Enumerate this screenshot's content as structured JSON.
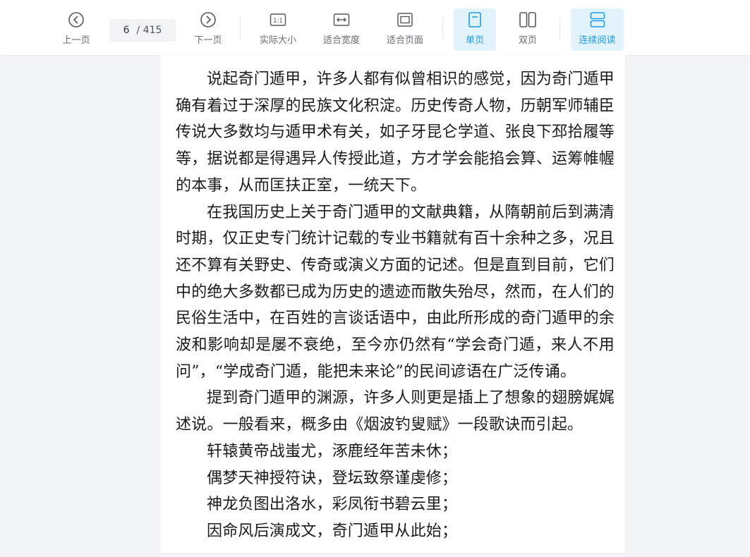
{
  "toolbar": {
    "prev_label": "上一页",
    "current_page": "6",
    "total_pages": "/ 415",
    "next_label": "下一页",
    "actual_size_label": "实际大小",
    "fit_width_label": "适合宽度",
    "fit_page_label": "适合页面",
    "single_page_label": "单页",
    "double_page_label": "双页",
    "continuous_label": "连续阅读",
    "actual_size_icon_text": "1:1",
    "accent_color": "#1a9be6"
  },
  "document": {
    "paragraphs": [
      "说起奇门遁甲，许多人都有似曾相识的感觉，因为奇门遁甲确有着过于深厚的民族文化积淀。历史传奇人物，历朝军师辅臣传说大多数均与遁甲术有关，如子牙昆仑学道、张良下邳拾履等等，据说都是得遇异人传授此道，方才学会能掐会算、运筹帷幄的本事，从而匡扶正室，一统天下。",
      "在我国历史上关于奇门遁甲的文献典籍，从隋朝前后到满清时期，仅正史专门统计记载的专业书籍就有百十余种之多，况且还不算有关野史、传奇或演义方面的记述。但是直到目前，它们中的绝大多数都已成为历史的遗迹而散失殆尽，然而，在人们的民俗生活中，在百姓的言谈话语中，由此所形成的奇门遁甲的余波和影响却是屡不衰绝，至今亦仍然有“学会奇门遁，来人不用问”，“学成奇门遁，能把未来论”的民间谚语在广泛传诵。",
      "提到奇门遁甲的渊源，许多人则更是插上了想象的翅膀娓娓述说。一般看来，概多由《烟波钓叟赋》一段歌诀而引起。"
    ],
    "poem": [
      "轩辕黄帝战蚩尤，涿鹿经年苦未休；",
      "偶梦天神授符诀，登坛致祭谨虔修；",
      "神龙负图出洛水，彩凤衔书碧云里；",
      "因命风后演成文，奇门遁甲从此始；"
    ]
  }
}
